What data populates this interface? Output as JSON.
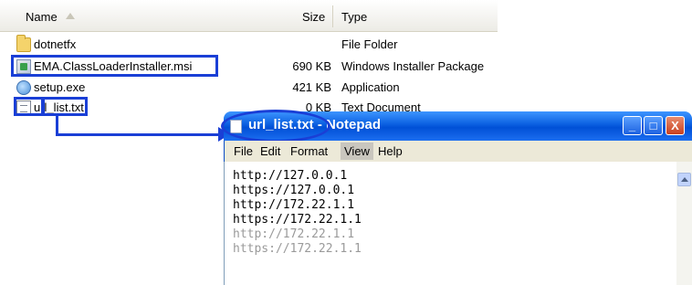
{
  "explorer": {
    "columns": {
      "name": "Name",
      "size": "Size",
      "type": "Type"
    },
    "files": [
      {
        "name": "dotnetfx",
        "size": "",
        "type": "File Folder",
        "icon": "folder-icon"
      },
      {
        "name": "EMA.ClassLoaderInstaller.msi",
        "size": "690 KB",
        "type": "Windows Installer Package",
        "icon": "msi-icon"
      },
      {
        "name": "setup.exe",
        "size": "421 KB",
        "type": "Application",
        "icon": "exe-icon"
      },
      {
        "name": "url_list.txt",
        "size": "0 KB",
        "type": "Text Document",
        "icon": "text-file-icon"
      }
    ]
  },
  "notepad": {
    "title": "url_list.txt - Notepad",
    "menu": [
      "File",
      "Edit",
      "Format",
      "View",
      "Help"
    ],
    "lines": [
      "http://127.0.0.1",
      "https://127.0.0.1",
      "http://172.22.1.1",
      "https://172.22.1.1",
      "http://172.22.1.1",
      "https://172.22.1.1"
    ],
    "controls": {
      "minimize": "_",
      "maximize": "□",
      "close": "X"
    }
  },
  "colors": {
    "highlight": "#1a3fd6",
    "titlebar": "#0a5fe0",
    "menubar": "#ece9d8"
  }
}
